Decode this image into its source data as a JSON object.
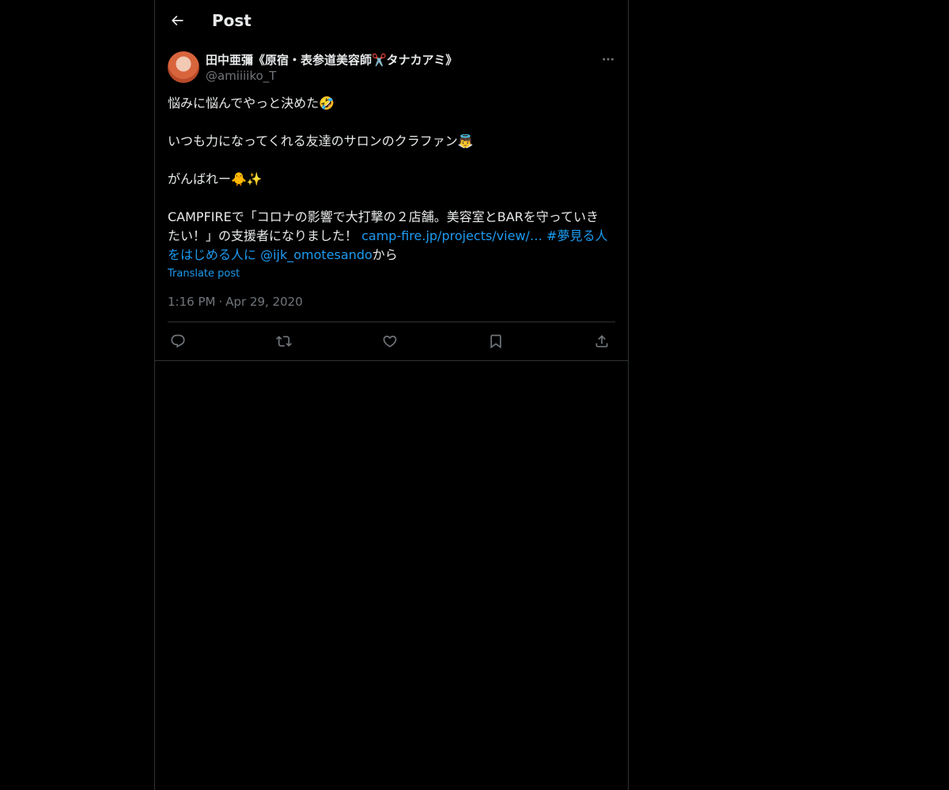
{
  "header": {
    "title": "Post",
    "back_icon": "arrow-left-icon"
  },
  "post": {
    "author": {
      "name": "田中亜彌《原宿・表参道美容師✂️タナカアミ》",
      "handle": "@amiiiiko_T",
      "avatar": "avatar-photo"
    },
    "more_icon": "more-icon",
    "body": {
      "line1": "悩みに悩んでやっと決めた🤣",
      "line2": "いつも力になってくれる友達のサロンのクラファン👼",
      "line3": "がんばれー🐥✨",
      "line4_prefix": "CAMPFIREで「コロナの影響で大打撃の２店舗。美容室とBARを守っていきたい！」の支援者になりました！ ",
      "link_url": "camp-fire.jp/projects/view/…",
      "hashtag": "#夢見る人をはじめる人に",
      "mention": "@ijk_omotesando",
      "suffix": "から"
    },
    "translate_label": "Translate post",
    "time": "1:16 PM",
    "date": "Apr 29, 2020",
    "separator": "·",
    "actions": {
      "reply_icon": "reply-icon",
      "repost_icon": "repost-icon",
      "like_icon": "heart-icon",
      "bookmark_icon": "bookmark-icon",
      "share_icon": "share-icon"
    }
  },
  "colors": {
    "background": "#000000",
    "text": "#e7e9ea",
    "muted": "#71767b",
    "accent": "#1d9bf0",
    "border": "#2f3336"
  }
}
